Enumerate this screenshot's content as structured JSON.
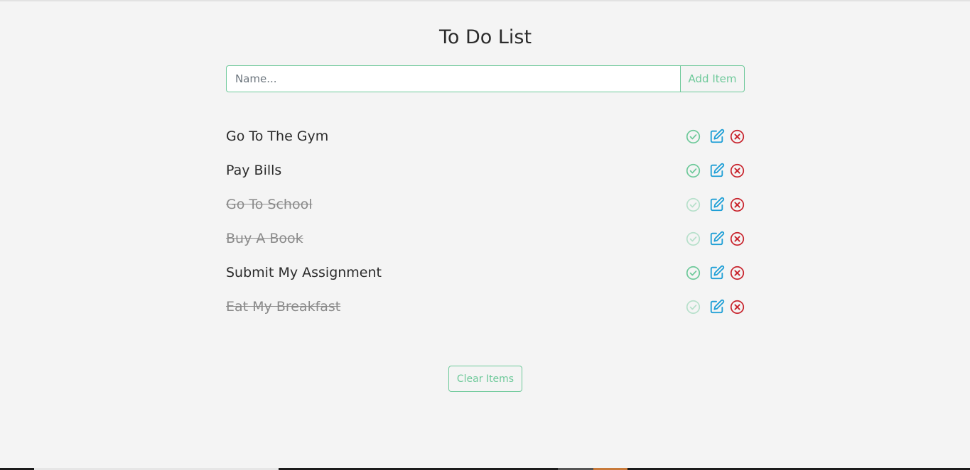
{
  "title": "To Do List",
  "input": {
    "placeholder": "Name...",
    "value": ""
  },
  "add_button_label": "Add Item",
  "items": [
    {
      "label": "Go To The Gym",
      "done": false
    },
    {
      "label": "Pay Bills",
      "done": false
    },
    {
      "label": "Go To School",
      "done": true
    },
    {
      "label": "Buy A Book",
      "done": true
    },
    {
      "label": "Submit My Assignment",
      "done": false
    },
    {
      "label": "Eat My Breakfast",
      "done": true
    }
  ],
  "clear_button_label": "Clear Items",
  "icons": {
    "complete": "check-circle-icon",
    "edit": "edit-icon",
    "delete": "close-circle-icon"
  },
  "colors": {
    "background": "#f4f4f4",
    "accent_green": "#6ec99a",
    "edit_blue": "#1f9fd6",
    "delete_red": "#c8232c",
    "text": "#2b2b2b",
    "done_text": "#8a8a8a"
  }
}
